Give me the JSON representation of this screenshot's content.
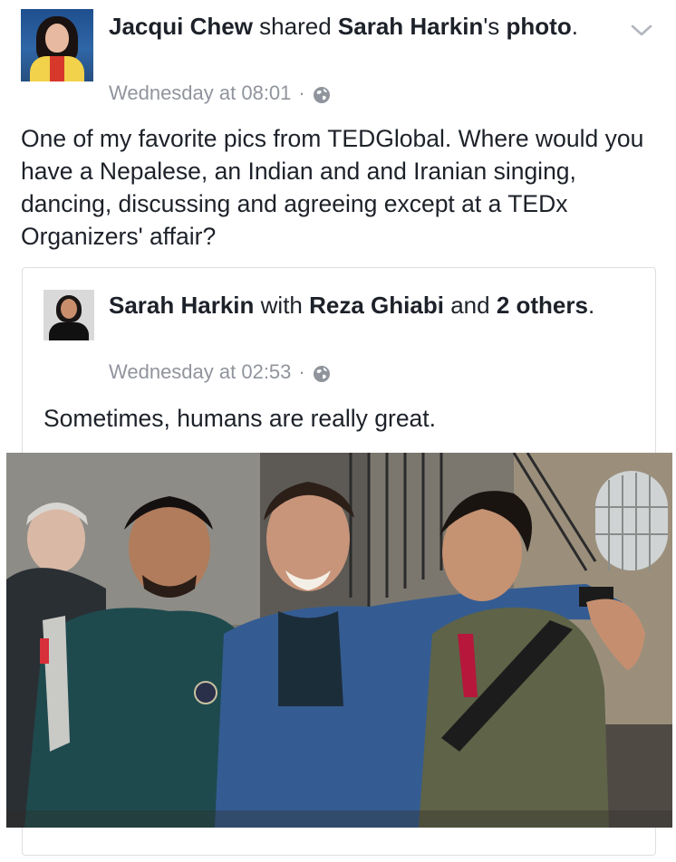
{
  "post": {
    "author": "Jacqui Chew",
    "action": "shared",
    "shared_owner": "Sarah Harkin",
    "shared_suffix": "'s",
    "shared_object": "photo",
    "period": ".",
    "timestamp": "Wednesday at 08:01",
    "separator": "·",
    "privacy_icon": "globe-icon",
    "menu_icon": "chevron-down-icon",
    "status_text": "One of my favorite pics from TEDGlobal. Where would you have a Nepalese, an Indian and and Iranian singing, dancing, discussing and agreeing except at a TEDx Organizers' affair?"
  },
  "shared": {
    "author": "Sarah Harkin",
    "with_word": "with",
    "tagged": "Reza Ghiabi",
    "and_word": "and",
    "others": "2 others",
    "period": ".",
    "timestamp": "Wednesday at 02:53",
    "separator": "·",
    "privacy_icon": "globe-icon",
    "text": "Sometimes, humans are really great."
  },
  "colors": {
    "text": "#1d2129",
    "meta": "#90949c",
    "border": "#dddfe2"
  }
}
